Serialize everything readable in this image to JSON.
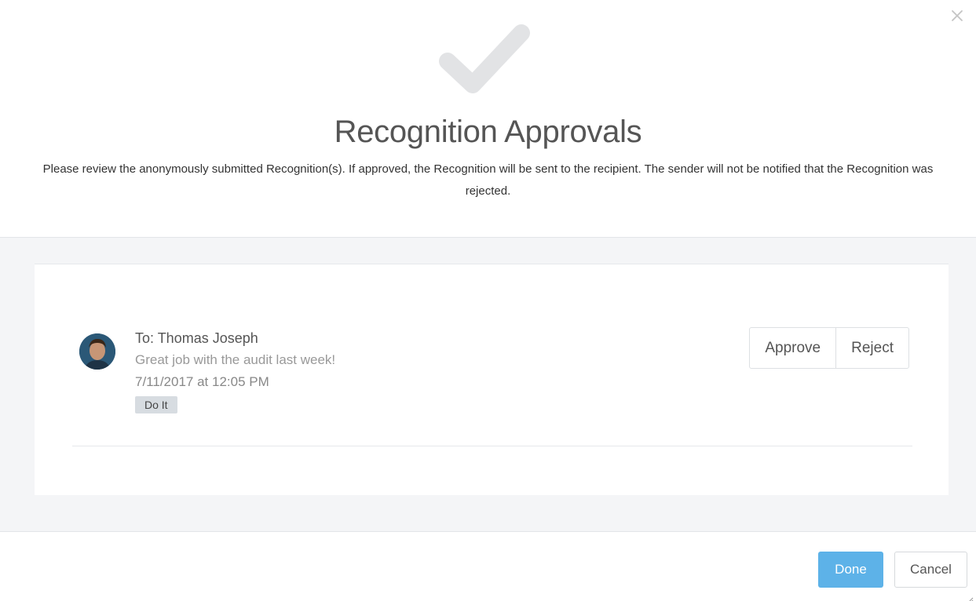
{
  "dialog": {
    "title": "Recognition Approvals",
    "subtitle": "Please review the anonymously submitted Recognition(s). If approved, the Recognition will be sent to the recipient. The sender will not be notified that the Recognition was rejected.",
    "close_icon": "close-icon",
    "header_icon": "checkmark-icon"
  },
  "recognitions": [
    {
      "to": "To: Thomas Joseph",
      "message": "Great job with the audit last week!",
      "timestamp": "7/11/2017 at 12:05 PM",
      "tag": "Do It",
      "approve_label": "Approve",
      "reject_label": "Reject"
    }
  ],
  "footer": {
    "done_label": "Done",
    "cancel_label": "Cancel"
  },
  "colors": {
    "primary": "#5db2e8",
    "body_bg": "#f4f5f7",
    "tag_bg": "#d7dce1"
  }
}
